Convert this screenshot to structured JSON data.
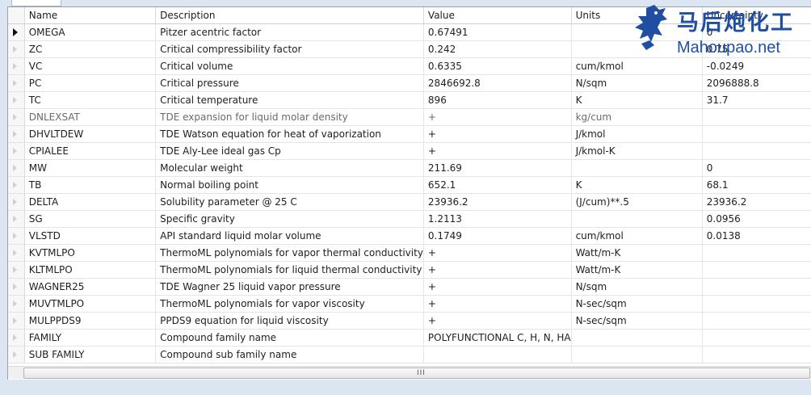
{
  "table": {
    "columns": [
      "Name",
      "Description",
      "Value",
      "Units",
      "Uncertainty"
    ],
    "rows": [
      {
        "name": "OMEGA",
        "description": "Pitzer acentric factor",
        "value": "0.67491",
        "units": "",
        "uncertainty": "0",
        "current": true
      },
      {
        "name": "ZC",
        "description": "Critical compressibility factor",
        "value": "0.242",
        "units": "",
        "uncertainty": "0.75"
      },
      {
        "name": "VC",
        "description": "Critical volume",
        "value": "0.6335",
        "units": "cum/kmol",
        "uncertainty": "-0.0249"
      },
      {
        "name": "PC",
        "description": "Critical pressure",
        "value": "2846692.8",
        "units": "N/sqm",
        "uncertainty": "2096888.8"
      },
      {
        "name": "TC",
        "description": "Critical temperature",
        "value": "896",
        "units": "K",
        "uncertainty": "31.7"
      },
      {
        "name": "DNLEXSAT",
        "description": "TDE expansion for liquid molar density",
        "value": "+",
        "units": "kg/cum",
        "uncertainty": "",
        "gray": true
      },
      {
        "name": "DHVLTDEW",
        "description": "TDE Watson equation for heat of vaporization",
        "value": "+",
        "units": "J/kmol",
        "uncertainty": ""
      },
      {
        "name": "CPIALEE",
        "description": "TDE Aly-Lee ideal gas Cp",
        "value": "+",
        "units": "J/kmol-K",
        "uncertainty": ""
      },
      {
        "name": "MW",
        "description": "Molecular weight",
        "value": "211.69",
        "units": "",
        "uncertainty": "0"
      },
      {
        "name": "TB",
        "description": "Normal boiling point",
        "value": "652.1",
        "units": "K",
        "uncertainty": "68.1"
      },
      {
        "name": "DELTA",
        "description": "Solubility parameter @ 25 C",
        "value": "23936.2",
        "units": "(J/cum)**.5",
        "uncertainty": "23936.2"
      },
      {
        "name": "SG",
        "description": "Specific gravity",
        "value": "1.2113",
        "units": "",
        "uncertainty": "0.0956"
      },
      {
        "name": "VLSTD",
        "description": "API standard liquid molar volume",
        "value": "0.1749",
        "units": "cum/kmol",
        "uncertainty": "0.0138"
      },
      {
        "name": "KVTMLPO",
        "description": "ThermoML polynomials for vapor thermal conductivity",
        "value": "+",
        "units": "Watt/m-K",
        "uncertainty": ""
      },
      {
        "name": "KLTMLPO",
        "description": "ThermoML polynomials for liquid thermal conductivity",
        "value": "+",
        "units": "Watt/m-K",
        "uncertainty": ""
      },
      {
        "name": "WAGNER25",
        "description": "TDE Wagner 25 liquid vapor pressure",
        "value": "+",
        "units": "N/sqm",
        "uncertainty": ""
      },
      {
        "name": "MUVTMLPO",
        "description": "ThermoML polynomials for vapor viscosity",
        "value": "+",
        "units": "N-sec/sqm",
        "uncertainty": ""
      },
      {
        "name": "MULPPDS9",
        "description": "PPDS9 equation for liquid viscosity",
        "value": "+",
        "units": "N-sec/sqm",
        "uncertainty": ""
      },
      {
        "name": "FAMILY",
        "description": "Compound family name",
        "value": "POLYFUNCTIONAL C, H, N, HA",
        "units": "",
        "uncertainty": ""
      },
      {
        "name": "SUB FAMILY",
        "description": "Compound sub family name",
        "value": "",
        "units": "",
        "uncertainty": ""
      }
    ]
  },
  "scrollbar": {
    "grip": "III"
  },
  "watermark": {
    "cn": "马后炮化工",
    "en": "Mahoupao.net"
  },
  "colors": {
    "watermark": "#1f4ea3",
    "background": "#dce6f2"
  }
}
